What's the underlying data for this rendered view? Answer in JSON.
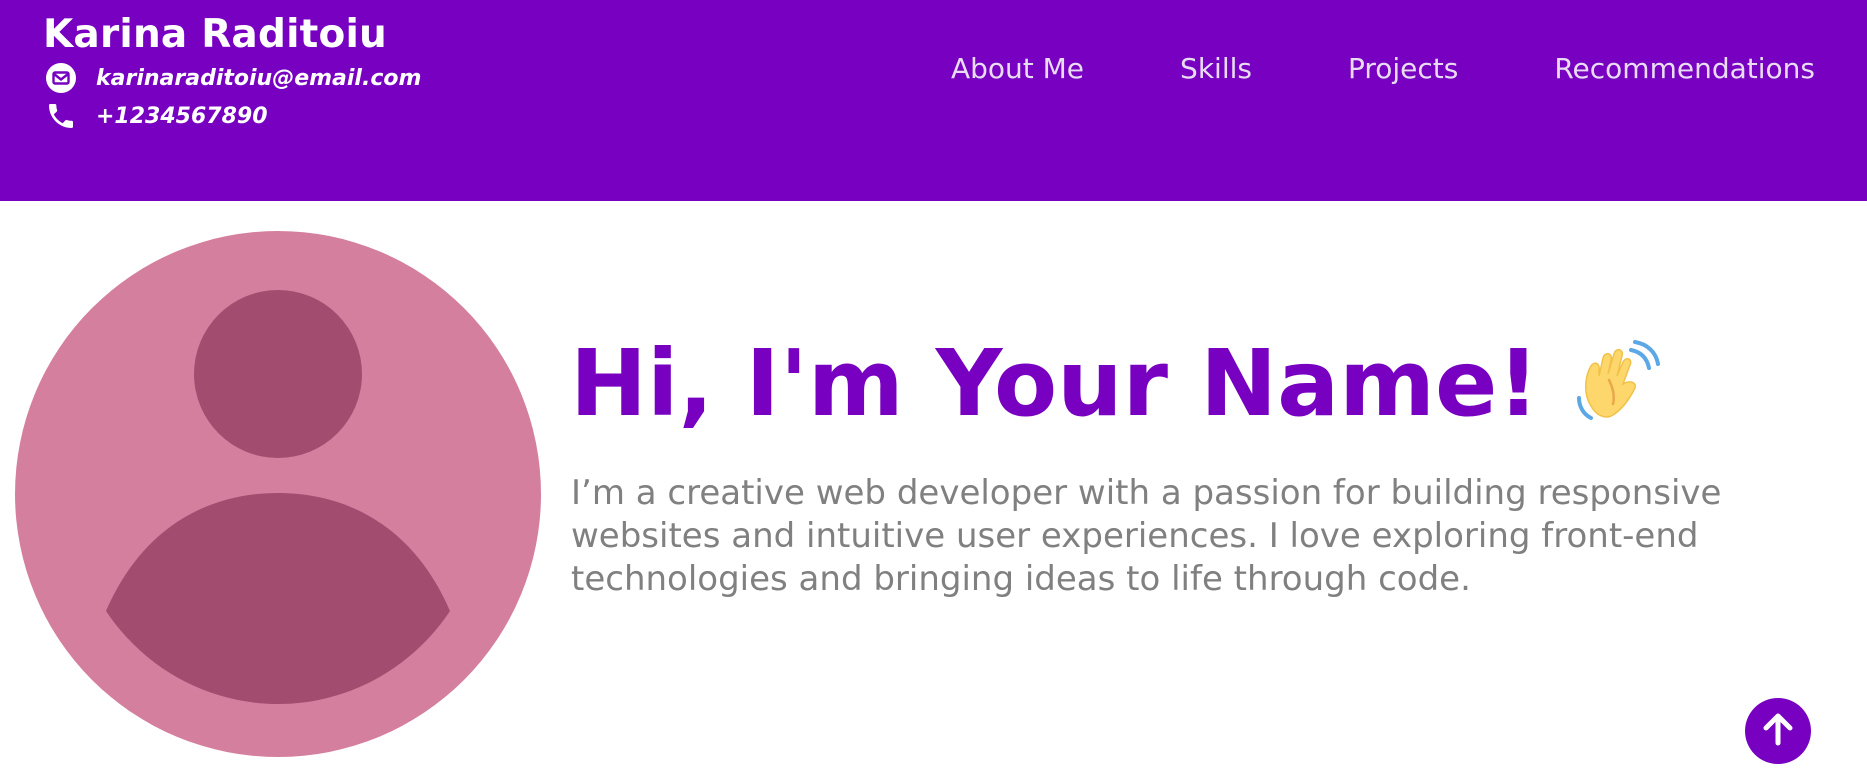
{
  "header": {
    "name": "Karina Raditoiu",
    "email": "karinaraditoiu@email.com",
    "phone": "+1234567890",
    "email_icon": "envelope-icon",
    "phone_icon": "phone-icon"
  },
  "nav": {
    "items": [
      {
        "label": "About Me"
      },
      {
        "label": "Skills"
      },
      {
        "label": "Projects"
      },
      {
        "label": "Recommendations"
      }
    ]
  },
  "hero": {
    "title": "Hi, I'm Your Name!",
    "title_icon": "waving-hand-icon",
    "description": "I’m a creative web developer with a passion for building responsive websites and intuitive user experiences. I love exploring front-end technologies and bringing ideas to life through code.",
    "avatar_icon": "user-avatar-icon"
  },
  "scroll_top": {
    "icon": "arrow-up-icon"
  },
  "colors": {
    "brand": "#7700c1",
    "nav_text": "#e9dcf2",
    "body_text": "#808080",
    "avatar_bg": "#d57f9e",
    "avatar_fg": "#a24c6f"
  }
}
